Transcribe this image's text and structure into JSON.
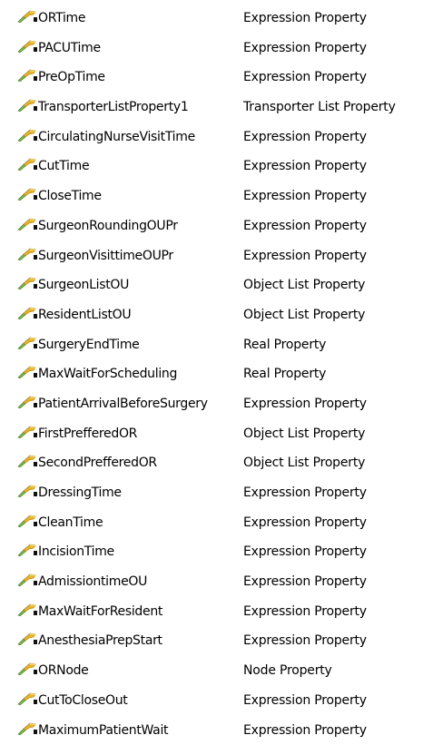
{
  "properties": [
    {
      "name": "ORTime",
      "type": "Expression Property"
    },
    {
      "name": "PACUTime",
      "type": "Expression Property"
    },
    {
      "name": "PreOpTime",
      "type": "Expression Property"
    },
    {
      "name": "TransporterListProperty1",
      "type": "Transporter List Property"
    },
    {
      "name": "CirculatingNurseVisitTime",
      "type": "Expression Property"
    },
    {
      "name": "CutTime",
      "type": "Expression Property"
    },
    {
      "name": "CloseTime",
      "type": "Expression Property"
    },
    {
      "name": "SurgeonRoundingOUPr",
      "type": "Expression Property"
    },
    {
      "name": "SurgeonVisittimeOUPr",
      "type": "Expression Property"
    },
    {
      "name": "SurgeonListOU",
      "type": "Object List Property"
    },
    {
      "name": "ResidentListOU",
      "type": "Object List Property"
    },
    {
      "name": "SurgeryEndTime",
      "type": "Real Property"
    },
    {
      "name": "MaxWaitForScheduling",
      "type": "Real Property"
    },
    {
      "name": "PatientArrivalBeforeSurgery",
      "type": "Expression Property"
    },
    {
      "name": "FirstPrefferedOR",
      "type": "Object List Property"
    },
    {
      "name": "SecondPrefferedOR",
      "type": "Object List Property"
    },
    {
      "name": "DressingTime",
      "type": "Expression Property"
    },
    {
      "name": "CleanTime",
      "type": "Expression Property"
    },
    {
      "name": "IncisionTime",
      "type": "Expression Property"
    },
    {
      "name": "AdmissiontimeOU",
      "type": "Expression Property"
    },
    {
      "name": "MaxWaitForResident",
      "type": "Expression Property"
    },
    {
      "name": "AnesthesiaPrepStart",
      "type": "Expression Property"
    },
    {
      "name": "ORNode",
      "type": "Node Property"
    },
    {
      "name": "CutToCloseOut",
      "type": "Expression Property"
    },
    {
      "name": "MaximumPatientWait",
      "type": "Expression Property"
    }
  ],
  "icon": "property-wrench-icon",
  "colors": {
    "text": "#000000",
    "background": "#ffffff",
    "icon_gold": "#d9a520",
    "icon_green": "#6aa84f"
  }
}
